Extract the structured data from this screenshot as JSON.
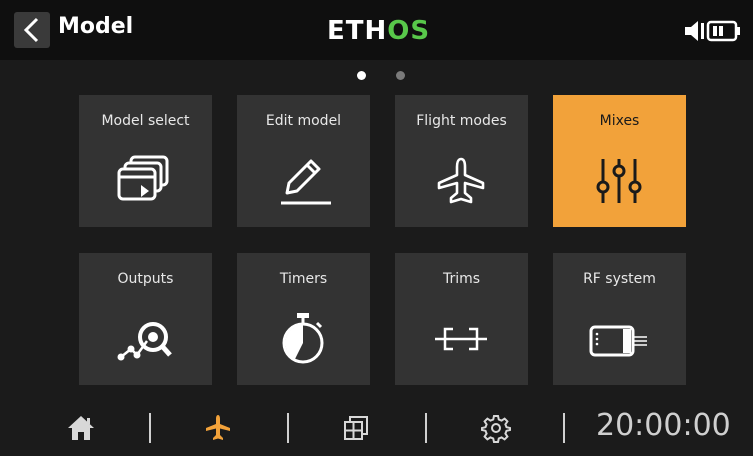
{
  "header": {
    "title": "Model",
    "logo_text_1": "ETH",
    "logo_text_2": "OS",
    "logo_colors": {
      "primary": "#ffffff",
      "accent": "#58c84a"
    }
  },
  "pager": {
    "pages": 2,
    "current": 1
  },
  "tiles": [
    {
      "label": "Model select",
      "icon": "model-select-icon",
      "active": false
    },
    {
      "label": "Edit model",
      "icon": "edit-pencil-icon",
      "active": false
    },
    {
      "label": "Flight modes",
      "icon": "airplane-icon",
      "active": false
    },
    {
      "label": "Mixes",
      "icon": "mixer-sliders-icon",
      "active": true
    },
    {
      "label": "Outputs",
      "icon": "outputs-icon",
      "active": false
    },
    {
      "label": "Timers",
      "icon": "stopwatch-icon",
      "active": false
    },
    {
      "label": "Trims",
      "icon": "trims-icon",
      "active": false
    },
    {
      "label": "RF system",
      "icon": "rf-module-icon",
      "active": false
    }
  ],
  "bottom_nav": [
    {
      "icon": "home-icon",
      "active": false
    },
    {
      "icon": "airplane-icon",
      "active": true
    },
    {
      "icon": "layout-grid-icon",
      "active": false
    },
    {
      "icon": "gear-icon",
      "active": false
    }
  ],
  "clock": "20:00:00",
  "colors": {
    "accent": "#f2a23a",
    "tile": "#333333",
    "background": "#1b1b1b",
    "header": "#0f0f0f"
  }
}
